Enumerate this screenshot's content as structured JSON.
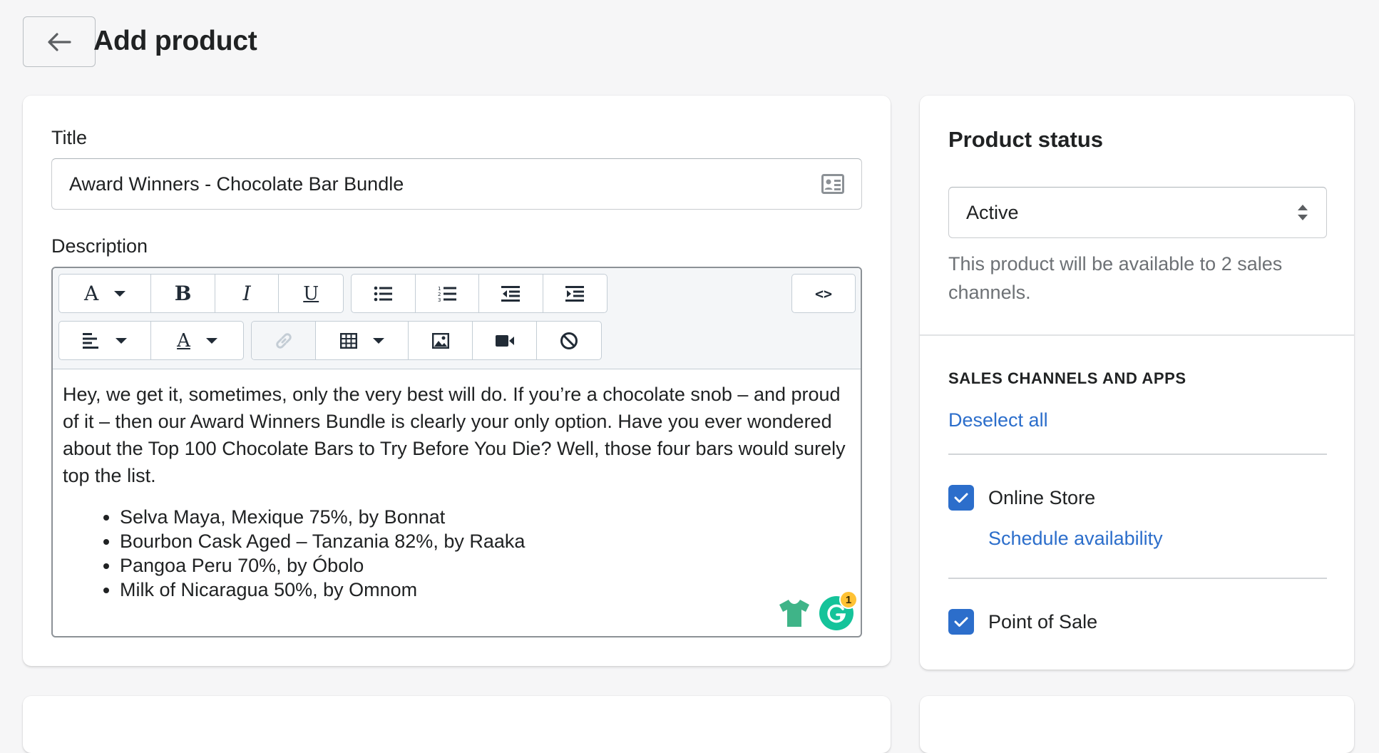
{
  "page": {
    "title": "Add product"
  },
  "main": {
    "title_label": "Title",
    "title_value": "Award Winners - Chocolate Bar Bundle",
    "description_label": "Description",
    "toolbar": {
      "code_label": "<>",
      "bold": "B",
      "italic": "I",
      "underline": "U",
      "font": "A",
      "color": "A"
    },
    "description": {
      "paragraph": "Hey, we get it, sometimes, only the very best will do. If you’re a chocolate snob – and proud of it – then our Award Winners Bundle is clearly your only option. Have you ever wondered about the Top 100 Chocolate Bars to Try Before You Die? Well, those four bars would surely top the list.",
      "bullets": [
        "Selva Maya, Mexique 75%, by Bonnat",
        "Bourbon Cask Aged – Tanzania 82%, by Raaka",
        "Pangoa Peru 70%, by Óbolo",
        "Milk of Nicaragua 50%, by Omnom"
      ]
    },
    "grammarly_count": "1"
  },
  "side": {
    "heading": "Product status",
    "status_value": "Active",
    "helper": "This product will be available to 2 sales channels.",
    "section_heading": "SALES CHANNELS AND APPS",
    "deselect_label": "Deselect all",
    "channels": [
      {
        "label": "Online Store",
        "checked": true
      },
      {
        "label": "Point of Sale",
        "checked": true
      }
    ],
    "schedule_label": "Schedule availability"
  },
  "colors": {
    "accent": "#2c6ecb",
    "grammarly": "#15c39a",
    "shirt": "#3fb488"
  }
}
